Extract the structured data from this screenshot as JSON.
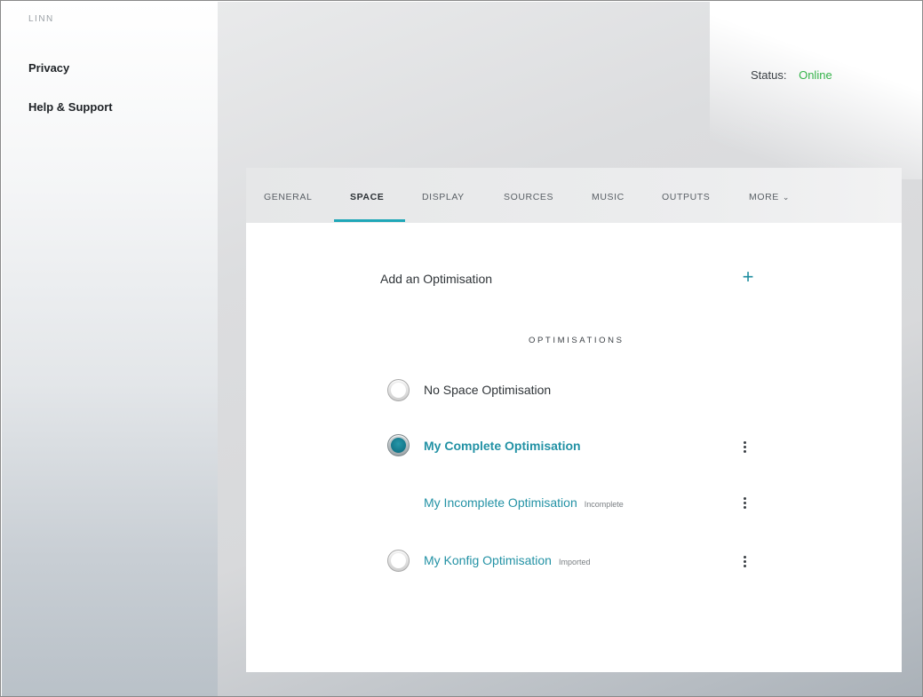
{
  "sidebar": {
    "brand": "LINN",
    "links": [
      "Privacy",
      "Help & Support"
    ]
  },
  "header": {
    "status_label": "Status:",
    "status_value": "Online",
    "status_color": "#35b34a"
  },
  "tabs": [
    {
      "label": "GENERAL"
    },
    {
      "label": "SPACE",
      "active": true
    },
    {
      "label": "DISPLAY"
    },
    {
      "label": "SOURCES"
    },
    {
      "label": "MUSIC"
    },
    {
      "label": "OUTPUTS"
    },
    {
      "label": "MORE"
    }
  ],
  "panel": {
    "add_label": "Add an Optimisation",
    "add_icon": "+",
    "section_heading": "OPTIMISATIONS",
    "optimisations": [
      {
        "name": "No Space Optimisation",
        "tag": "",
        "selected": false,
        "has_radio": true,
        "has_menu": false
      },
      {
        "name": "My Complete Optimisation",
        "tag": "",
        "selected": true,
        "has_radio": true,
        "has_menu": true
      },
      {
        "name": "My Incomplete Optimisation",
        "tag": "Incomplete",
        "selected": false,
        "has_radio": false,
        "has_menu": true
      },
      {
        "name": "My Konfig Optimisation",
        "tag": "Imported",
        "selected": false,
        "has_radio": true,
        "has_menu": true
      }
    ]
  },
  "colors": {
    "accent": "#1fa7b8",
    "link": "#2392a5",
    "online": "#35b34a"
  }
}
